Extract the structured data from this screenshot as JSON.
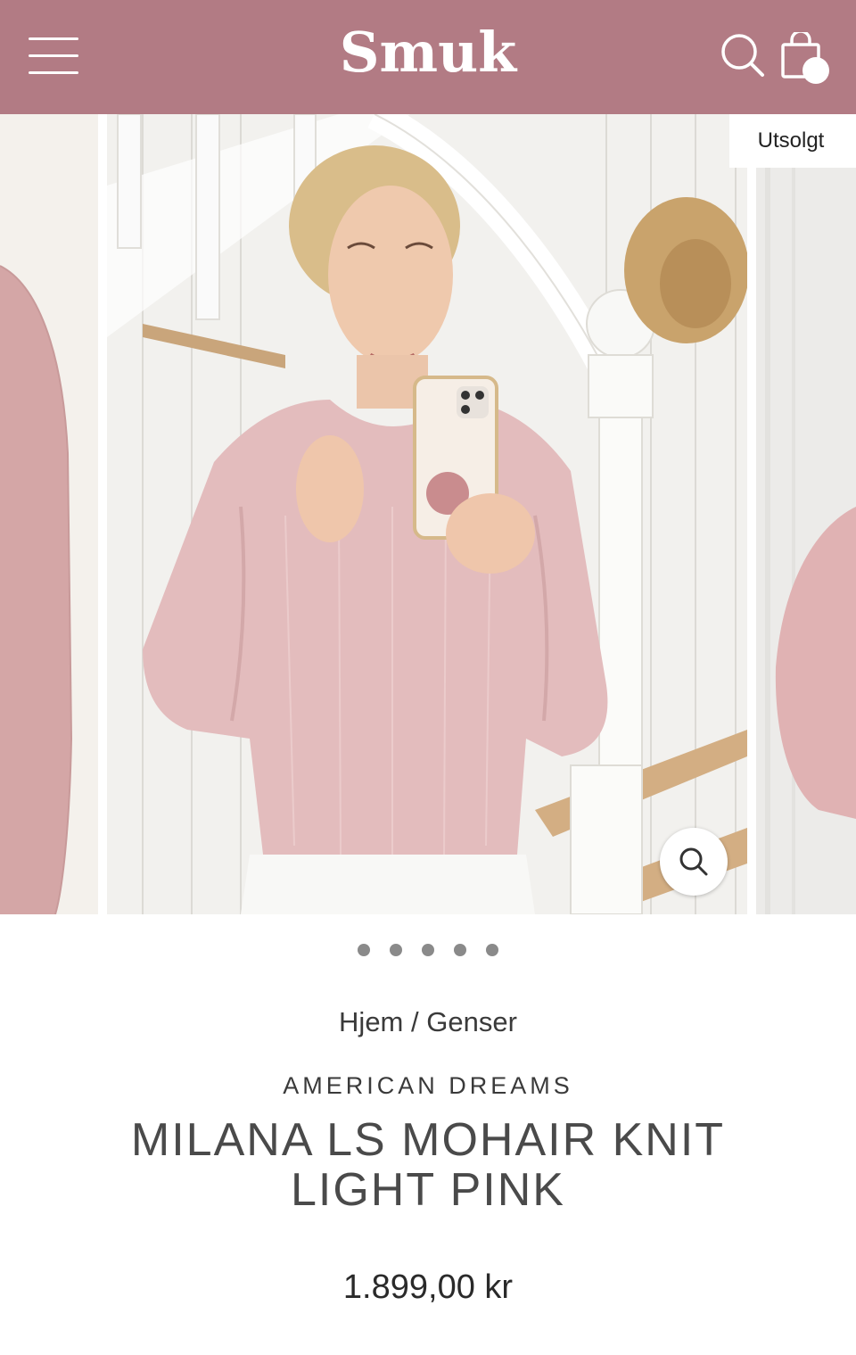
{
  "header": {
    "logo": "Smuk",
    "menu_icon": "menu-icon",
    "search_icon": "search-icon",
    "cart_icon": "shopping-bag-icon",
    "background_color": "#b27b84"
  },
  "gallery": {
    "badge": "Utsolgt",
    "zoom_icon": "zoom-icon",
    "slide_count": 5,
    "active_slide": 1
  },
  "product": {
    "breadcrumb": {
      "home": "Hjem",
      "separator": "/",
      "category": "Genser"
    },
    "brand": "AMERICAN DREAMS",
    "title": "MILANA LS MOHAIR KNIT LIGHT PINK",
    "price": "1.899,00 kr"
  }
}
